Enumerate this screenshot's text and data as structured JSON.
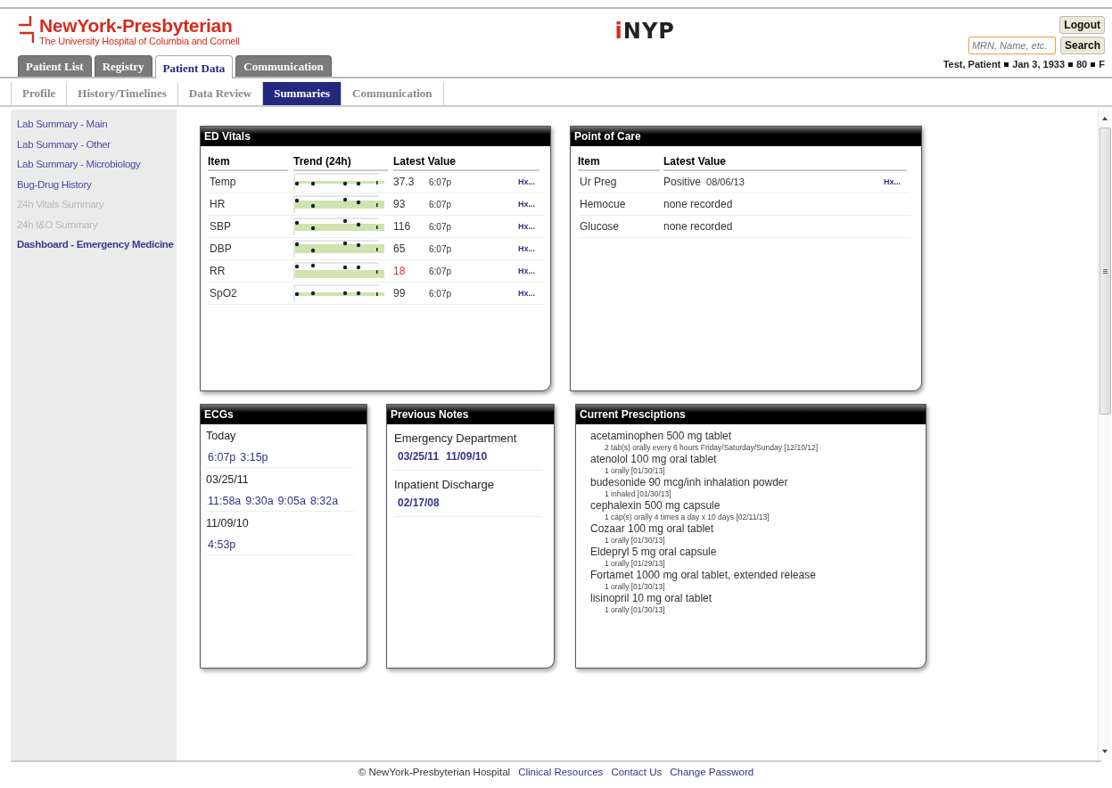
{
  "header": {
    "brand": "NewYork-Presbyterian",
    "brand_subtitle": "The University Hospital of Columbia and Cornell",
    "app_logo": {
      "accent": "i",
      "rest": "NYP"
    },
    "logout": "Logout",
    "search": {
      "placeholder": "MRN, Name, etc.",
      "button": "Search"
    },
    "patient": [
      "Test, Patient",
      "Jan 3, 1933",
      "80",
      "F"
    ]
  },
  "tabs": [
    {
      "label": "Patient List",
      "selected": false
    },
    {
      "label": "Registry",
      "selected": false
    },
    {
      "label": "Patient Data",
      "selected": true
    },
    {
      "label": "Communication",
      "selected": false
    }
  ],
  "subtabs": [
    {
      "label": "Profile",
      "selected": false
    },
    {
      "label": "History/Timelines",
      "selected": false
    },
    {
      "label": "Data Review",
      "selected": false
    },
    {
      "label": "Summaries",
      "selected": true
    },
    {
      "label": "Communication",
      "selected": false
    }
  ],
  "sidebar": {
    "items": [
      {
        "label": "Lab Summary - Main",
        "disabled": false,
        "selected": false
      },
      {
        "label": "Lab Summary - Other",
        "disabled": false,
        "selected": false
      },
      {
        "label": "Lab Summary - Microbiology",
        "disabled": false,
        "selected": false
      },
      {
        "label": "Bug-Drug History",
        "disabled": false,
        "selected": false
      },
      {
        "label": "24h Vitals Summary",
        "disabled": true,
        "selected": false
      },
      {
        "label": "24h I&O Summary",
        "disabled": true,
        "selected": false
      },
      {
        "label": "Dashboard - Emergency Medicine",
        "disabled": false,
        "selected": true
      }
    ]
  },
  "ed_vitals": {
    "title": "ED Vitals",
    "columns": [
      "Item",
      "Trend (24h)",
      "Latest Value"
    ],
    "rows": [
      {
        "item": "Temp",
        "value": "37.3",
        "time": "6:07p",
        "abnormal": false,
        "link": "Hx..."
      },
      {
        "item": "HR",
        "value": "93",
        "time": "6:07p",
        "abnormal": false,
        "link": "Hx..."
      },
      {
        "item": "SBP",
        "value": "116",
        "time": "6:07p",
        "abnormal": false,
        "link": "Hx..."
      },
      {
        "item": "DBP",
        "value": "65",
        "time": "6:07p",
        "abnormal": false,
        "link": "Hx..."
      },
      {
        "item": "RR",
        "value": "18",
        "time": "6:07p",
        "abnormal": true,
        "link": "Hx..."
      },
      {
        "item": "SpO2",
        "value": "99",
        "time": "6:07p",
        "abnormal": false,
        "link": "Hx..."
      }
    ]
  },
  "point_of_care": {
    "title": "Point of Care",
    "columns": [
      "Item",
      "Latest Value"
    ],
    "rows": [
      {
        "item": "Ur Preg",
        "value": "Positive",
        "date": "08/06/13",
        "link": "Hx..."
      },
      {
        "item": "Hemocue",
        "value": "none recorded"
      },
      {
        "item": "Glucose",
        "value": "none recorded"
      }
    ]
  },
  "ecgs": {
    "title": "ECGs",
    "groups": [
      {
        "date": "Today",
        "times": [
          "6:07p",
          "3:15p"
        ]
      },
      {
        "date": "03/25/11",
        "times": [
          "11:58a",
          "9:30a",
          "9:05a",
          "8:32a"
        ]
      },
      {
        "date": "11/09/10",
        "times": [
          "4:53p"
        ]
      }
    ]
  },
  "previous_notes": {
    "title": "Previous Notes",
    "groups": [
      {
        "type": "Emergency Department",
        "dates": [
          "03/25/11",
          "11/09/10"
        ]
      },
      {
        "type": "Inpatient Discharge",
        "dates": [
          "02/17/08"
        ]
      }
    ]
  },
  "prescriptions": {
    "title": "Current Presciptions",
    "items": [
      {
        "drug": "acetaminophen 500 mg tablet",
        "sig": "2 tab(s) orally every 6 hours Friday/Saturday/Sunday [12/10/12]"
      },
      {
        "drug": "atenolol 100 mg oral tablet",
        "sig": "1 orally [01/30/13]"
      },
      {
        "drug": "budesonide 90 mcg/inh inhalation powder",
        "sig": "1 inhaled [01/30/13]"
      },
      {
        "drug": "cephalexin 500 mg capsule",
        "sig": "1 cap(s) orally 4 times a day x 10 days [02/11/13]"
      },
      {
        "drug": "Cozaar 100 mg oral tablet",
        "sig": "1 orally [01/30/13]"
      },
      {
        "drug": "Eldepryl 5 mg oral capsule",
        "sig": "1 orally [01/29/13]"
      },
      {
        "drug": "Fortamet 1000 mg oral tablet, extended release",
        "sig": "1 orally [01/30/13]"
      },
      {
        "drug": "lisinopril 10 mg oral tablet",
        "sig": "1 orally [01/30/13]"
      }
    ]
  },
  "footer": {
    "copyright": "© NewYork-Presbyterian Hospital",
    "links": [
      "Clinical Resources",
      "Contact Us",
      "Change Password"
    ]
  }
}
